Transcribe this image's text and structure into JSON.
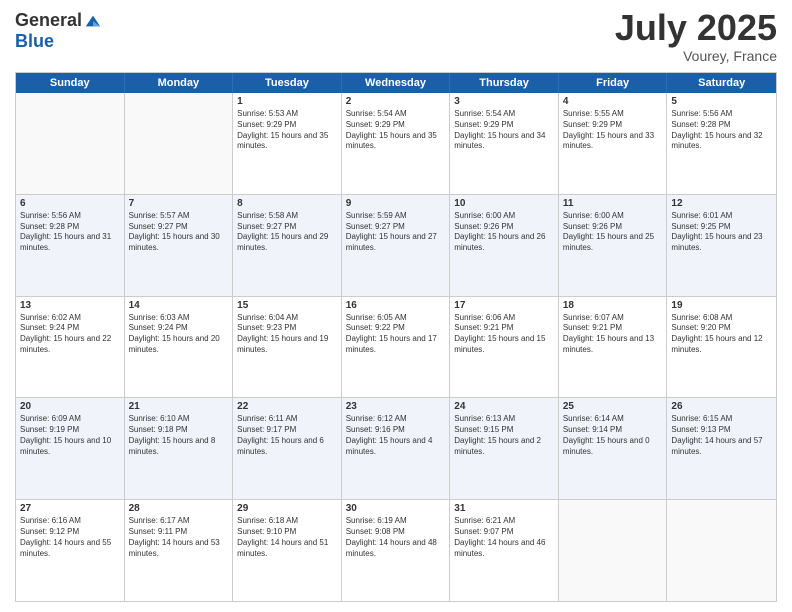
{
  "header": {
    "logo_general": "General",
    "logo_blue": "Blue",
    "month": "July 2025",
    "location": "Vourey, France"
  },
  "days_of_week": [
    "Sunday",
    "Monday",
    "Tuesday",
    "Wednesday",
    "Thursday",
    "Friday",
    "Saturday"
  ],
  "rows": [
    [
      {
        "day": "",
        "empty": true
      },
      {
        "day": "",
        "empty": true
      },
      {
        "day": "1",
        "sunrise": "Sunrise: 5:53 AM",
        "sunset": "Sunset: 9:29 PM",
        "daylight": "Daylight: 15 hours and 35 minutes."
      },
      {
        "day": "2",
        "sunrise": "Sunrise: 5:54 AM",
        "sunset": "Sunset: 9:29 PM",
        "daylight": "Daylight: 15 hours and 35 minutes."
      },
      {
        "day": "3",
        "sunrise": "Sunrise: 5:54 AM",
        "sunset": "Sunset: 9:29 PM",
        "daylight": "Daylight: 15 hours and 34 minutes."
      },
      {
        "day": "4",
        "sunrise": "Sunrise: 5:55 AM",
        "sunset": "Sunset: 9:29 PM",
        "daylight": "Daylight: 15 hours and 33 minutes."
      },
      {
        "day": "5",
        "sunrise": "Sunrise: 5:56 AM",
        "sunset": "Sunset: 9:28 PM",
        "daylight": "Daylight: 15 hours and 32 minutes."
      }
    ],
    [
      {
        "day": "6",
        "sunrise": "Sunrise: 5:56 AM",
        "sunset": "Sunset: 9:28 PM",
        "daylight": "Daylight: 15 hours and 31 minutes."
      },
      {
        "day": "7",
        "sunrise": "Sunrise: 5:57 AM",
        "sunset": "Sunset: 9:27 PM",
        "daylight": "Daylight: 15 hours and 30 minutes."
      },
      {
        "day": "8",
        "sunrise": "Sunrise: 5:58 AM",
        "sunset": "Sunset: 9:27 PM",
        "daylight": "Daylight: 15 hours and 29 minutes."
      },
      {
        "day": "9",
        "sunrise": "Sunrise: 5:59 AM",
        "sunset": "Sunset: 9:27 PM",
        "daylight": "Daylight: 15 hours and 27 minutes."
      },
      {
        "day": "10",
        "sunrise": "Sunrise: 6:00 AM",
        "sunset": "Sunset: 9:26 PM",
        "daylight": "Daylight: 15 hours and 26 minutes."
      },
      {
        "day": "11",
        "sunrise": "Sunrise: 6:00 AM",
        "sunset": "Sunset: 9:26 PM",
        "daylight": "Daylight: 15 hours and 25 minutes."
      },
      {
        "day": "12",
        "sunrise": "Sunrise: 6:01 AM",
        "sunset": "Sunset: 9:25 PM",
        "daylight": "Daylight: 15 hours and 23 minutes."
      }
    ],
    [
      {
        "day": "13",
        "sunrise": "Sunrise: 6:02 AM",
        "sunset": "Sunset: 9:24 PM",
        "daylight": "Daylight: 15 hours and 22 minutes."
      },
      {
        "day": "14",
        "sunrise": "Sunrise: 6:03 AM",
        "sunset": "Sunset: 9:24 PM",
        "daylight": "Daylight: 15 hours and 20 minutes."
      },
      {
        "day": "15",
        "sunrise": "Sunrise: 6:04 AM",
        "sunset": "Sunset: 9:23 PM",
        "daylight": "Daylight: 15 hours and 19 minutes."
      },
      {
        "day": "16",
        "sunrise": "Sunrise: 6:05 AM",
        "sunset": "Sunset: 9:22 PM",
        "daylight": "Daylight: 15 hours and 17 minutes."
      },
      {
        "day": "17",
        "sunrise": "Sunrise: 6:06 AM",
        "sunset": "Sunset: 9:21 PM",
        "daylight": "Daylight: 15 hours and 15 minutes."
      },
      {
        "day": "18",
        "sunrise": "Sunrise: 6:07 AM",
        "sunset": "Sunset: 9:21 PM",
        "daylight": "Daylight: 15 hours and 13 minutes."
      },
      {
        "day": "19",
        "sunrise": "Sunrise: 6:08 AM",
        "sunset": "Sunset: 9:20 PM",
        "daylight": "Daylight: 15 hours and 12 minutes."
      }
    ],
    [
      {
        "day": "20",
        "sunrise": "Sunrise: 6:09 AM",
        "sunset": "Sunset: 9:19 PM",
        "daylight": "Daylight: 15 hours and 10 minutes."
      },
      {
        "day": "21",
        "sunrise": "Sunrise: 6:10 AM",
        "sunset": "Sunset: 9:18 PM",
        "daylight": "Daylight: 15 hours and 8 minutes."
      },
      {
        "day": "22",
        "sunrise": "Sunrise: 6:11 AM",
        "sunset": "Sunset: 9:17 PM",
        "daylight": "Daylight: 15 hours and 6 minutes."
      },
      {
        "day": "23",
        "sunrise": "Sunrise: 6:12 AM",
        "sunset": "Sunset: 9:16 PM",
        "daylight": "Daylight: 15 hours and 4 minutes."
      },
      {
        "day": "24",
        "sunrise": "Sunrise: 6:13 AM",
        "sunset": "Sunset: 9:15 PM",
        "daylight": "Daylight: 15 hours and 2 minutes."
      },
      {
        "day": "25",
        "sunrise": "Sunrise: 6:14 AM",
        "sunset": "Sunset: 9:14 PM",
        "daylight": "Daylight: 15 hours and 0 minutes."
      },
      {
        "day": "26",
        "sunrise": "Sunrise: 6:15 AM",
        "sunset": "Sunset: 9:13 PM",
        "daylight": "Daylight: 14 hours and 57 minutes."
      }
    ],
    [
      {
        "day": "27",
        "sunrise": "Sunrise: 6:16 AM",
        "sunset": "Sunset: 9:12 PM",
        "daylight": "Daylight: 14 hours and 55 minutes."
      },
      {
        "day": "28",
        "sunrise": "Sunrise: 6:17 AM",
        "sunset": "Sunset: 9:11 PM",
        "daylight": "Daylight: 14 hours and 53 minutes."
      },
      {
        "day": "29",
        "sunrise": "Sunrise: 6:18 AM",
        "sunset": "Sunset: 9:10 PM",
        "daylight": "Daylight: 14 hours and 51 minutes."
      },
      {
        "day": "30",
        "sunrise": "Sunrise: 6:19 AM",
        "sunset": "Sunset: 9:08 PM",
        "daylight": "Daylight: 14 hours and 48 minutes."
      },
      {
        "day": "31",
        "sunrise": "Sunrise: 6:21 AM",
        "sunset": "Sunset: 9:07 PM",
        "daylight": "Daylight: 14 hours and 46 minutes."
      },
      {
        "day": "",
        "empty": true
      },
      {
        "day": "",
        "empty": true
      }
    ]
  ]
}
